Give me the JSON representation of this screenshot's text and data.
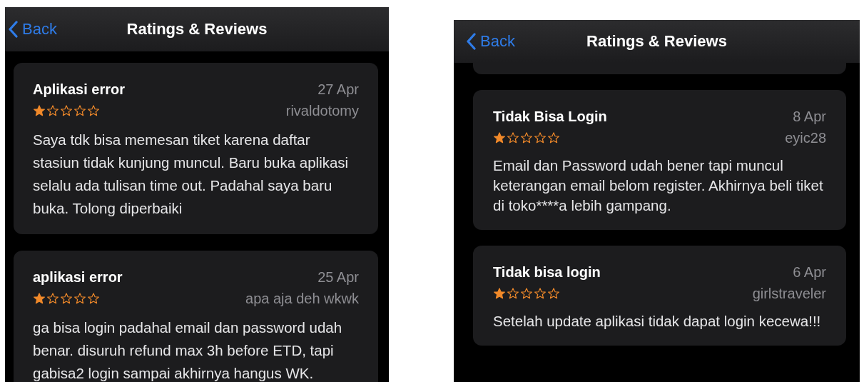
{
  "screens": [
    {
      "back_label": "Back",
      "title": "Ratings & Reviews",
      "cut_card_above": false,
      "reviews": [
        {
          "title": "Aplikasi error",
          "date": "27 Apr",
          "author": "rivaldotomy",
          "stars": 1,
          "body": "Saya tdk bisa memesan tiket karena daftar stasiun tidak kunjung muncul. Baru buka aplikasi selalu ada tulisan time out. Padahal saya baru buka. Tolong diperbaiki"
        },
        {
          "title": "aplikasi error",
          "date": "25 Apr",
          "author": "apa aja deh wkwk",
          "stars": 1,
          "body": "ga bisa login padahal email dan password udah benar. disuruh refund max 3h before ETD, tapi gabisa2 login sampai akhirnya hangus WK."
        }
      ]
    },
    {
      "back_label": "Back",
      "title": "Ratings & Reviews",
      "cut_card_above": true,
      "reviews": [
        {
          "title": "Tidak Bisa Login",
          "date": "8 Apr",
          "author": "eyic28",
          "stars": 1,
          "body": "Email dan Password udah bener tapi muncul keterangan email belom register. Akhirnya beli tiket di toko****a lebih gampang."
        },
        {
          "title": "Tidak bisa login",
          "date": "6 Apr",
          "author": "girlstraveler",
          "stars": 1,
          "body": "Setelah update aplikasi tidak dapat login kecewa!!!"
        }
      ]
    }
  ]
}
